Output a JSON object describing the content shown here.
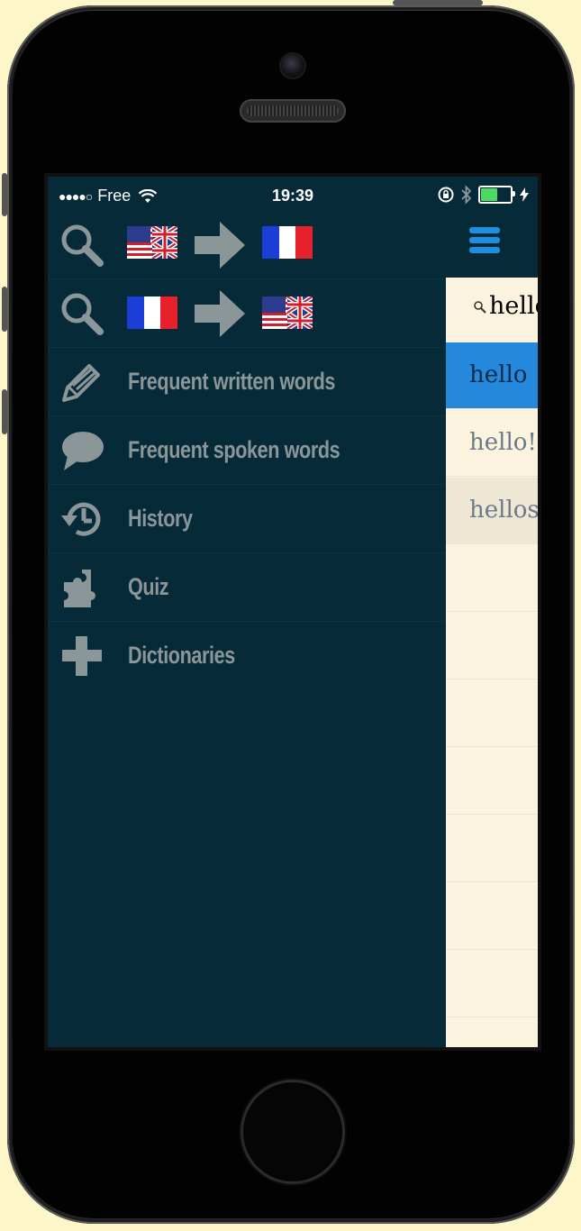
{
  "statusbar": {
    "carrier": "Free",
    "time": "19:39"
  },
  "nav": {
    "direction_en_fr": {
      "source_flag": "uk-us-flag",
      "target_flag": "france-flag"
    },
    "direction_fr_en": {
      "source_flag": "france-flag",
      "target_flag": "uk-us-flag"
    },
    "items": [
      {
        "label": "Frequent written words",
        "icon": "pen-icon"
      },
      {
        "label": "Frequent spoken words",
        "icon": "speech-bubble-icon"
      },
      {
        "label": "History",
        "icon": "history-icon"
      },
      {
        "label": "Quiz",
        "icon": "puzzle-icon"
      },
      {
        "label": "Dictionaries",
        "icon": "plus-icon"
      }
    ]
  },
  "search": {
    "value": "hello"
  },
  "results": [
    {
      "text": "hello",
      "state": "selected"
    },
    {
      "text": "hello!",
      "state": "normal"
    },
    {
      "text": "hellos",
      "state": "shaded"
    }
  ],
  "colors": {
    "background": "#fdf6c8",
    "menu_bg": "#062a38",
    "menu_text": "#8a9698",
    "accent": "#1e8fe0",
    "selected_row": "#2488dc",
    "results_bg": "#fbf3de"
  }
}
